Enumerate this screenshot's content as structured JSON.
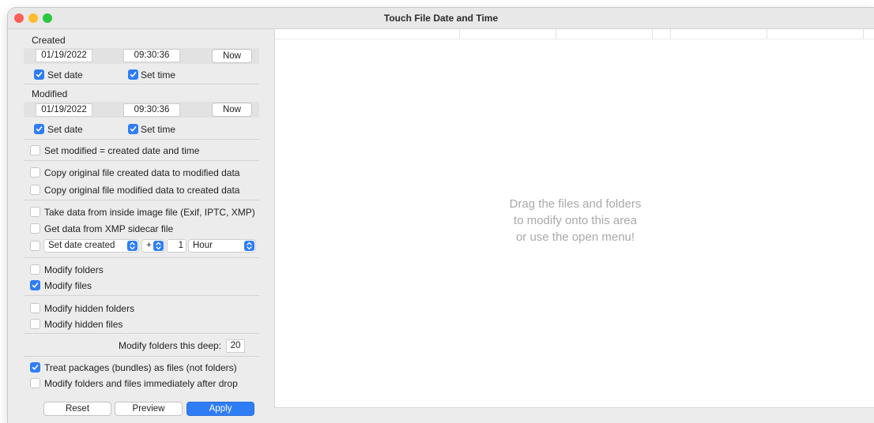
{
  "window": {
    "title": "Touch File Date and Time"
  },
  "created": {
    "label": "Created",
    "date": "01/19/2022",
    "time": "09:30:36",
    "now_label": "Now",
    "set_date_label": "Set date",
    "set_time_label": "Set time",
    "set_date_checked": true,
    "set_time_checked": true
  },
  "modified": {
    "label": "Modified",
    "date": "01/19/2022",
    "time": "09:30:36",
    "now_label": "Now",
    "set_date_label": "Set date",
    "set_time_label": "Set time",
    "set_date_checked": true,
    "set_time_checked": true
  },
  "options": {
    "set_modified_equal": "Set modified = created date and time",
    "copy_created_to_modified": "Copy original file created data to modified data",
    "copy_modified_to_created": "Copy original file modified data to created data",
    "take_from_image": "Take data from inside image file (Exif, IPTC, XMP)",
    "xmp_sidecar": "Get data from XMP sidecar file",
    "shift": {
      "field_selected": "Set date created",
      "sign_selected": "+",
      "amount": "1",
      "unit_selected": "Hour"
    },
    "modify_folders": "Modify folders",
    "modify_files": "Modify files",
    "modify_hidden_folders": "Modify hidden folders",
    "modify_hidden_files": "Modify hidden files",
    "depth_label": "Modify folders this deep:",
    "depth_value": "20",
    "treat_packages": "Treat packages (bundles) as files (not folders)",
    "modify_after_drop": "Modify folders and files immediately after drop"
  },
  "checked": {
    "modify_files": true,
    "treat_packages": true
  },
  "buttons": {
    "reset": "Reset",
    "preview": "Preview",
    "apply": "Apply"
  },
  "drop_area": {
    "line1": "Drag the files and folders",
    "line2": "to modify onto this area",
    "line3": "or use the open menu!"
  },
  "colors": {
    "accent": "#2f7df6",
    "close": "#fe5f57",
    "minimize": "#febc2e",
    "maximize": "#28c840"
  }
}
